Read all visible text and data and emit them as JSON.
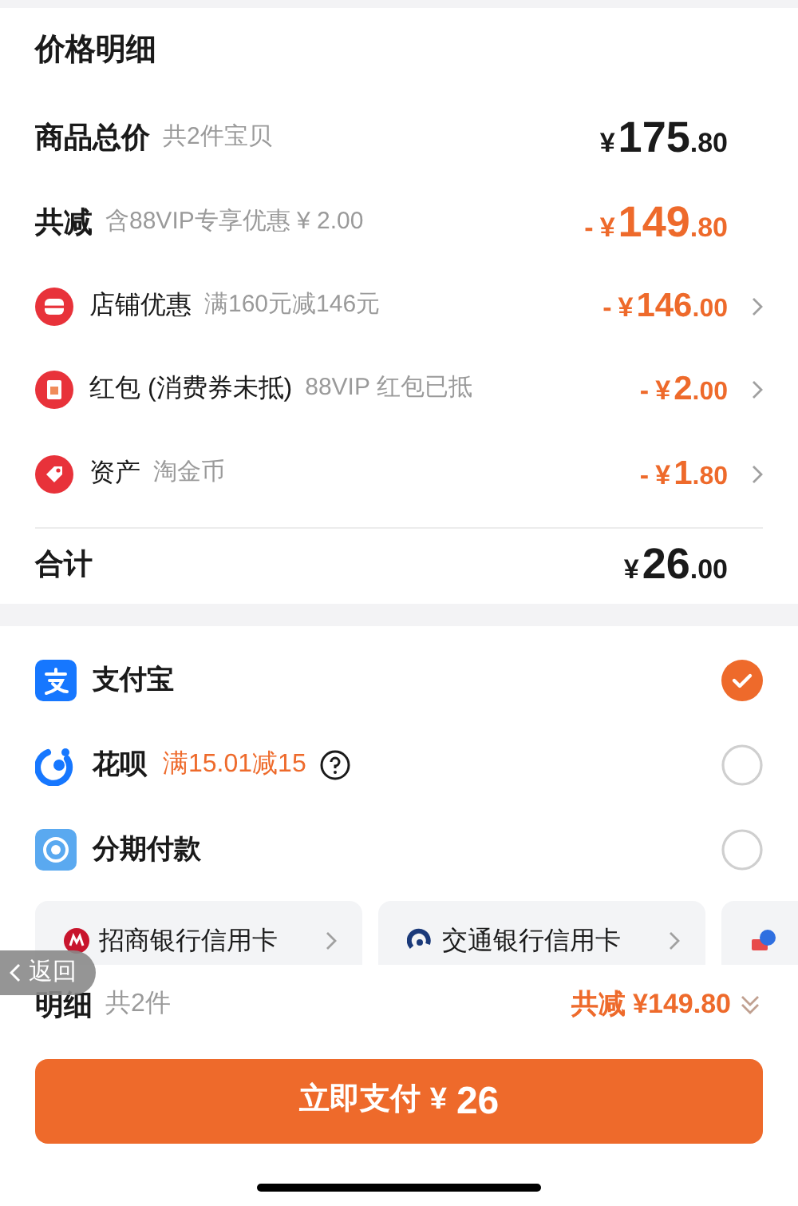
{
  "header": {
    "title": "价格明细"
  },
  "price_rows": [
    {
      "kind": "subtotal",
      "label": "商品总价",
      "note": "共2件宝贝",
      "amount": {
        "currency": "¥",
        "main": "175",
        "cents": ".80"
      }
    },
    {
      "kind": "reduction",
      "label": "共减",
      "note": "含88VIP专享优惠 ¥ 2.00",
      "amount": {
        "sign": "-",
        "currency": "¥",
        "main": "149",
        "cents": ".80"
      }
    },
    {
      "kind": "discount",
      "label": "店铺优惠",
      "note": "满160元减146元",
      "amount": {
        "sign": "-",
        "currency": "¥",
        "main": "146",
        "cents": ".00"
      }
    },
    {
      "kind": "discount",
      "label": "红包 (消费券未抵)",
      "note": "88VIP 红包已抵",
      "amount": {
        "sign": "-",
        "currency": "¥",
        "main": "2",
        "cents": ".00"
      }
    },
    {
      "kind": "discount",
      "label": "资产",
      "note": "淘金币",
      "amount": {
        "sign": "-",
        "currency": "¥",
        "main": "1",
        "cents": ".80"
      }
    }
  ],
  "total": {
    "label": "合计",
    "amount": {
      "currency": "¥",
      "main": "26",
      "cents": ".00"
    }
  },
  "payment_methods": [
    {
      "label": "支付宝",
      "selected": true
    },
    {
      "label": "花呗",
      "promo": "满15.01减15",
      "help": true,
      "selected": false
    },
    {
      "label": "分期付款",
      "selected": false
    }
  ],
  "bank_cards": [
    {
      "kind": "card",
      "label": "招商银行信用卡"
    },
    {
      "kind": "card",
      "label": "交通银行信用卡"
    },
    {
      "kind": "cut_off"
    }
  ],
  "back_button": {
    "label": "返回"
  },
  "footer": {
    "label": "明细",
    "count": "共2件",
    "savings": "共减 ¥149.80"
  },
  "pay_button": {
    "label": "立即支付",
    "currency": "¥",
    "amount": "26"
  }
}
